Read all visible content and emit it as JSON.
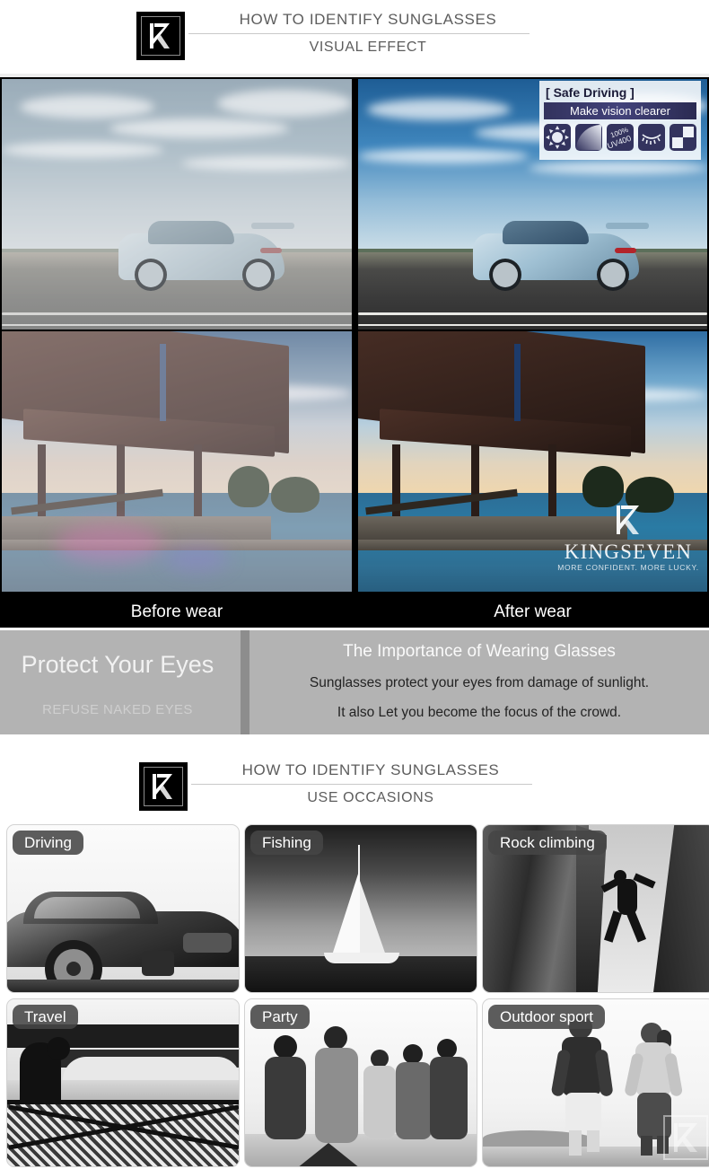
{
  "headers": [
    {
      "title": "HOW TO IDENTIFY SUNGLASSES",
      "subtitle": "VISUAL EFFECT",
      "logo_icon": "kingseven-logo-icon"
    },
    {
      "title": "HOW TO IDENTIFY SUNGLASSES",
      "subtitle": "USE OCCASIONS",
      "logo_icon": "kingseven-logo-icon"
    }
  ],
  "badge": {
    "bracket_left": "[",
    "bracket_right": "]",
    "title": "Safe Driving",
    "subtitle": "Make vision clearer",
    "icons": [
      {
        "name": "sun-icon",
        "label": "sun"
      },
      {
        "name": "gradient-lens-icon",
        "label": "gradient lens"
      },
      {
        "name": "uv400-icon",
        "label": "100% UV400"
      },
      {
        "name": "eye-lash-icon",
        "label": "eye protection"
      },
      {
        "name": "polarized-checker-icon",
        "label": "polarized"
      }
    ]
  },
  "comparison": {
    "before_label": "Before wear",
    "after_label": "After wear"
  },
  "watermark": {
    "brand": "KINGSEVEN",
    "tagline": "MORE CONFIDENT. MORE LUCKY.",
    "mark_icon": "kingseven-logo-icon"
  },
  "protect": {
    "title": "Protect Your Eyes",
    "subtitle": "REFUSE NAKED EYES",
    "heading": "The Importance of Wearing Glasses",
    "line1": "Sunglasses protect your eyes from damage of sunlight.",
    "line2": "It also Let you become the focus of the crowd."
  },
  "occasions": [
    {
      "label": "Driving",
      "scene": "car"
    },
    {
      "label": "Fishing",
      "scene": "sailboat"
    },
    {
      "label": "Rock climbing",
      "scene": "cliff"
    },
    {
      "label": "Travel",
      "scene": "bridge"
    },
    {
      "label": "Party",
      "scene": "party"
    },
    {
      "label": "Outdoor sport",
      "scene": "runners"
    }
  ],
  "colors": {
    "panel_gray": "#b3b3b3",
    "divider_gray": "#8d8d8d",
    "tag_gray": "#464646",
    "badge_navy": "#33335e",
    "header_text": "#5d5d5d",
    "black": "#000000"
  }
}
